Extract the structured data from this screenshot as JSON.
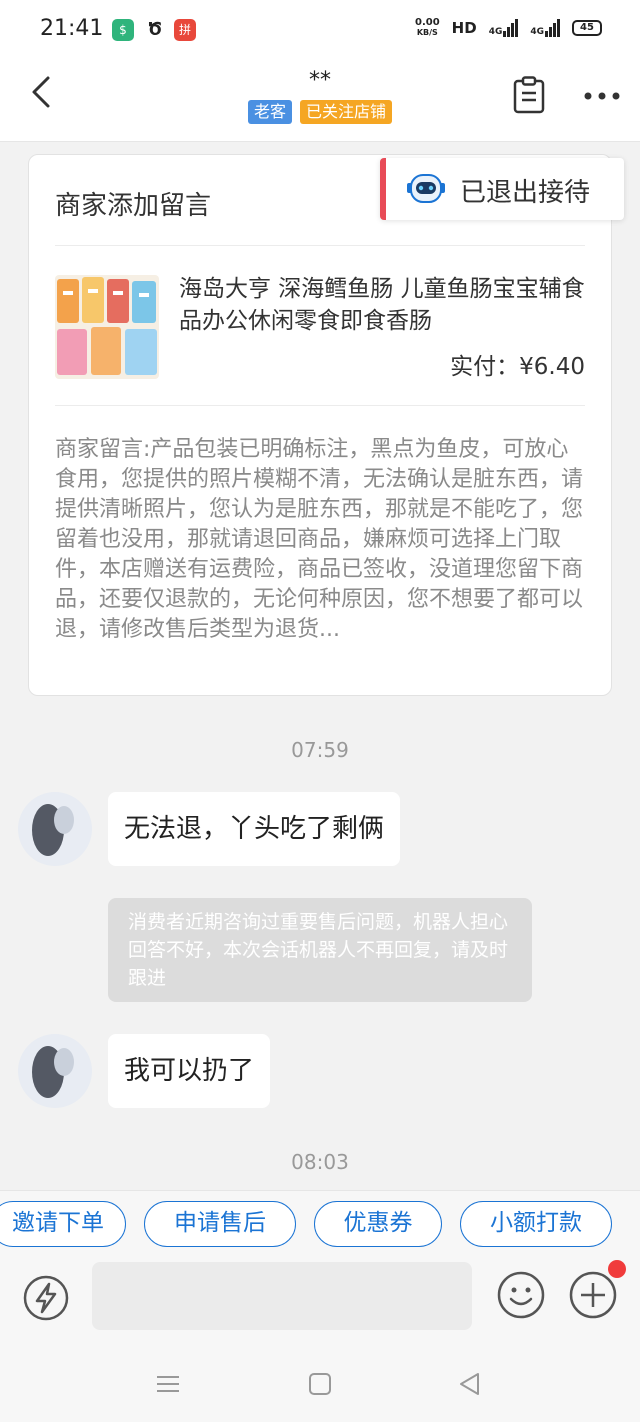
{
  "status_bar": {
    "time": "21:41",
    "speed_value": "0.00",
    "speed_unit": "KB/S",
    "hd": "HD",
    "net1": "4G",
    "net2": "4G",
    "battery": "45"
  },
  "header": {
    "title": "**",
    "tags": [
      "老客",
      "已关注店铺"
    ]
  },
  "card": {
    "title": "商家添加留言",
    "exit_badge": "已退出接待",
    "product_name": "海岛大亨 深海鳕鱼肠 儿童鱼肠宝宝辅食品办公休闲零食即食香肠",
    "price": "实付：¥6.40",
    "merchant_message": "商家留言:产品包装已明确标注，黑点为鱼皮，可放心食用，您提供的照片模糊不清，无法确认是脏东西，请提供清晰照片，您认为是脏东西，那就是不能吃了，您留着也没用，那就请退回商品，嫌麻烦可选择上门取件，本店赠送有运费险，商品已签收，没道理您留下商品，还要仅退款的，无论何种原因，您不想要了都可以退，请修改售后类型为退货..."
  },
  "chat": {
    "time1": "07:59",
    "msg1": "无法退，丫头吃了剩俩",
    "system_notice": "消费者近期咨询过重要售后问题，机器人担心回答不好，本次会话机器人不再回复，请及时跟进",
    "msg2": "我可以扔了",
    "time2": "08:03"
  },
  "quick_actions": [
    "邀请下单",
    "申请售后",
    "优惠券",
    "小额打款"
  ],
  "colors": {
    "accent_blue": "#1b74d4",
    "tag_blue": "#4a90e2",
    "tag_orange": "#f5a623",
    "badge_red": "#e84b57"
  }
}
